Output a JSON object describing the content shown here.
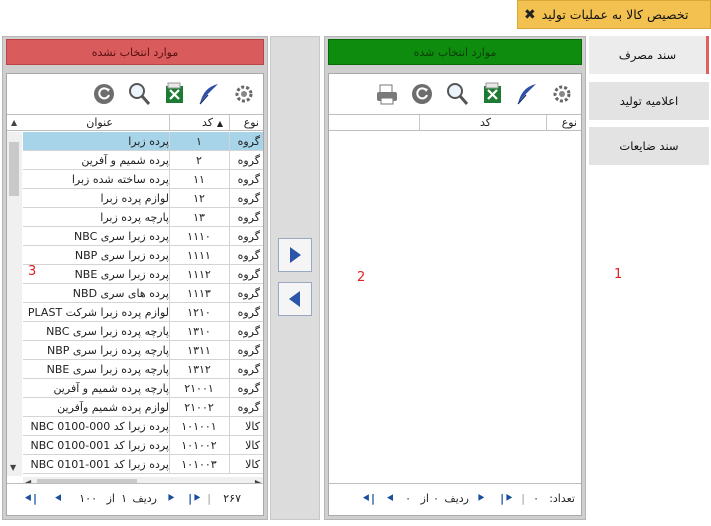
{
  "window": {
    "title": "تخصیص کالا به عملیات تولید",
    "close_glyph": "✖"
  },
  "side_tabs": [
    {
      "label": "سند مصرف"
    },
    {
      "label": "اعلامیه تولید"
    },
    {
      "label": "سند ضایعات"
    }
  ],
  "selected_panel": {
    "header": "موارد انتخاب شده",
    "columns": {
      "type": "نوع",
      "code": "کد"
    },
    "footer": {
      "count_label": "تعداد:",
      "count_value": "۰",
      "row_label": "ردیف",
      "row_value": "۰",
      "of_label": "از",
      "of_value": "۰"
    }
  },
  "unselected_panel": {
    "header": "موارد انتخاب نشده",
    "columns": {
      "type": "نوع",
      "code": "کد",
      "title": "عنوان"
    },
    "rows": [
      {
        "type": "گروه",
        "code": "۱",
        "title": "پرده زبرا",
        "selected": true
      },
      {
        "type": "گروه",
        "code": "۲",
        "title": "پرده شمیم و آفرین"
      },
      {
        "type": "گروه",
        "code": "۱۱",
        "title": "پرده ساخته شده زبرا"
      },
      {
        "type": "گروه",
        "code": "۱۲",
        "title": "لوازم پرده زبرا"
      },
      {
        "type": "گروه",
        "code": "۱۳",
        "title": "پارچه پرده زبرا"
      },
      {
        "type": "گروه",
        "code": "۱۱۱۰",
        "title": "پرده زبرا سری NBC"
      },
      {
        "type": "گروه",
        "code": "۱۱۱۱",
        "title": "پرده زبرا سری NBP"
      },
      {
        "type": "گروه",
        "code": "۱۱۱۲",
        "title": "پرده زبرا سری NBE"
      },
      {
        "type": "گروه",
        "code": "۱۱۱۳",
        "title": "پرده های سری NBD"
      },
      {
        "type": "گروه",
        "code": "۱۲۱۰",
        "title": "لوازم پرده زبرا شرکت PLAST"
      },
      {
        "type": "گروه",
        "code": "۱۳۱۰",
        "title": "پارچه پرده زبرا سری NBC"
      },
      {
        "type": "گروه",
        "code": "۱۳۱۱",
        "title": "پارچه پرده زبرا سری NBP"
      },
      {
        "type": "گروه",
        "code": "۱۳۱۲",
        "title": "پارچه پرده زبرا سری NBE"
      },
      {
        "type": "گروه",
        "code": "۲۱۰۰۱",
        "title": "پارچه پرده شمیم و آفرین"
      },
      {
        "type": "گروه",
        "code": "۲۱۰۰۲",
        "title": "لوازم پرده شمیم وآفرین"
      },
      {
        "type": "کالا",
        "code": "۱۰۱۰۰۱",
        "title": "پرده زبرا کد NBC 0100-000"
      },
      {
        "type": "کالا",
        "code": "۱۰۱۰۰۲",
        "title": "پرده زبرا کد NBC 0100-001"
      },
      {
        "type": "کالا",
        "code": "۱۰۱۰۰۳",
        "title": "پرده زبرا کد NBC 0101-001"
      }
    ],
    "footer": {
      "count_value": "۲۶۷",
      "row_label": "ردیف",
      "row_value": "۱",
      "of_label": "از",
      "of_value": "۱۰۰"
    }
  },
  "markers": {
    "one": "1",
    "two": "2",
    "three": "3"
  },
  "icons": {
    "settings": "gear-icon",
    "edit": "feather-pen-icon",
    "excel": "excel-icon",
    "search": "magnifier-icon",
    "refresh": "refresh-icon",
    "print": "printer-icon"
  },
  "colors": {
    "selected_header": "#0e8c0e",
    "unselected_header": "#d95b5b",
    "title_bar": "#f2c150",
    "row_highlight": "#a8d4ea"
  }
}
